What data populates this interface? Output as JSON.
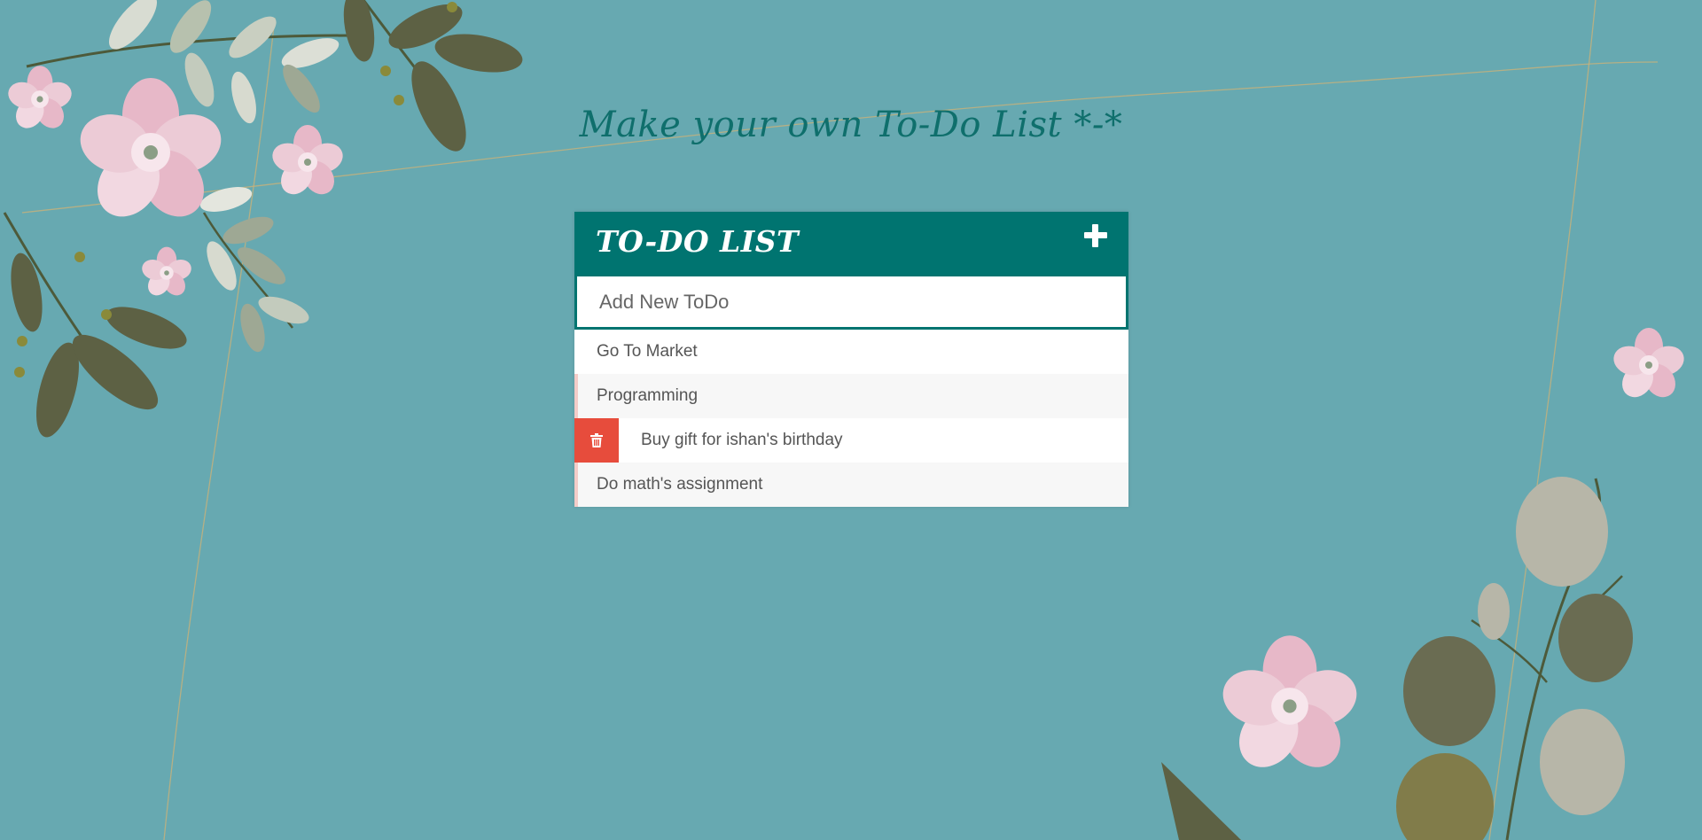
{
  "page": {
    "title": "Make your own To-Do List *-*"
  },
  "card": {
    "heading": "TO-DO LIST",
    "add_icon": "plus-icon",
    "input": {
      "placeholder": "Add New ToDo",
      "value": ""
    },
    "items": [
      {
        "text": "Go To Market",
        "state": "normal"
      },
      {
        "text": "Programming",
        "state": "peek"
      },
      {
        "text": "Buy gift for ishan's birthday",
        "state": "hover"
      },
      {
        "text": "Do math's assignment",
        "state": "peek"
      }
    ],
    "delete_icon": "trash-icon"
  },
  "colors": {
    "background": "#67a9b1",
    "header": "#007470",
    "title": "#0f6f6c",
    "delete": "#e74c3c",
    "row_alt": "#f7f7f7"
  }
}
